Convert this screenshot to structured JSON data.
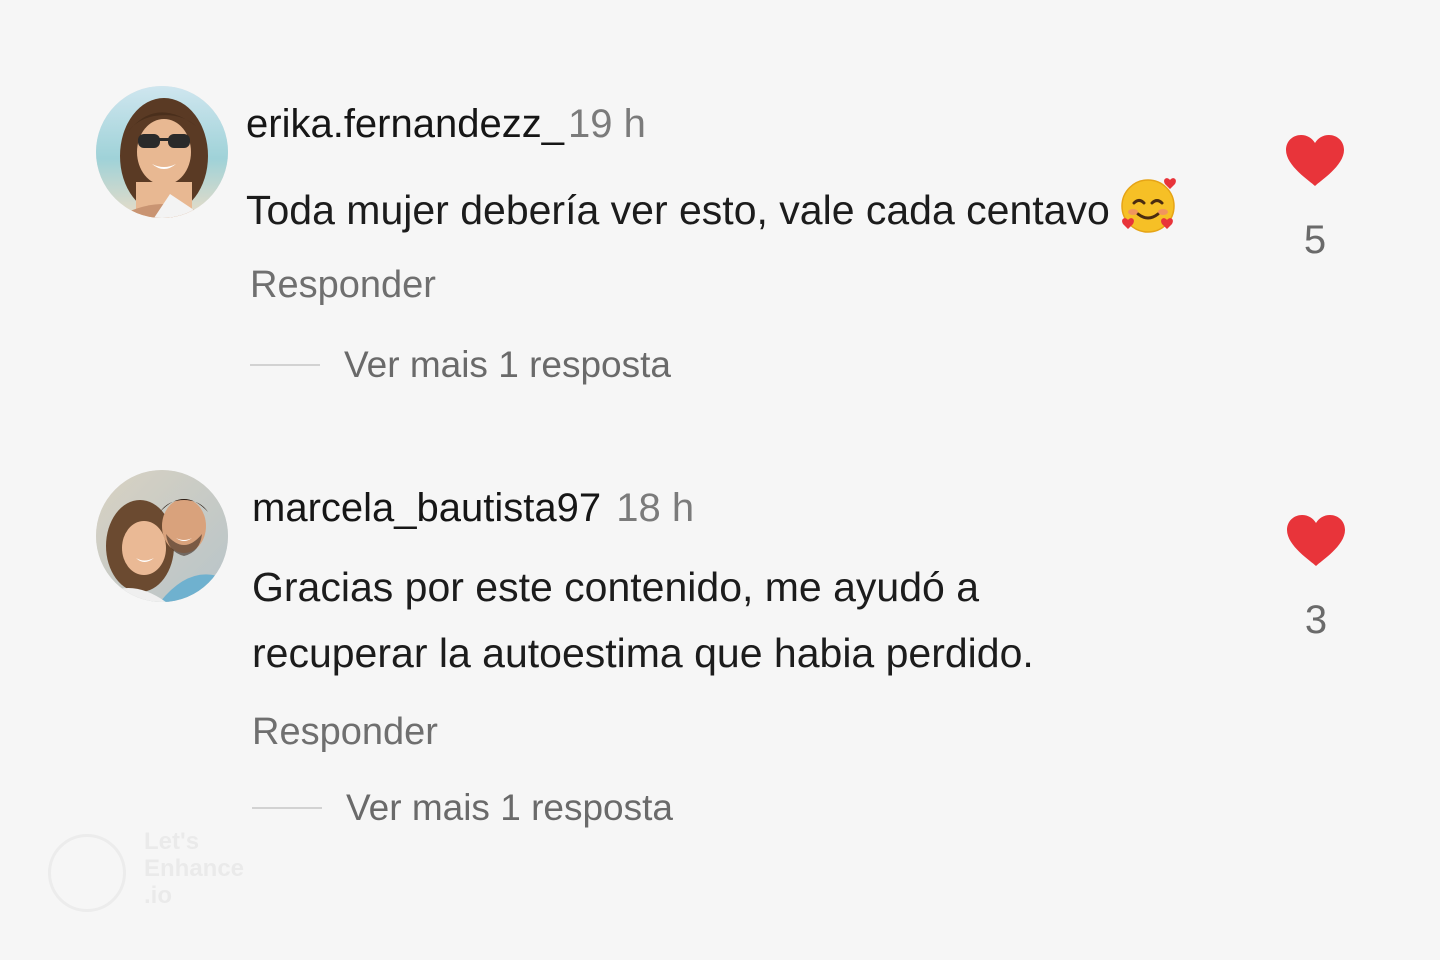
{
  "comments": [
    {
      "username": "erika.fernandezz_",
      "time": "19 h",
      "text_lines": [
        "Toda mujer debería ver esto, vale cada centavo"
      ],
      "emoji": "smiling-face-with-hearts",
      "reply_label": "Responder",
      "view_more_label": "Ver mais 1 resposta",
      "like_count": "5",
      "avatar": "woman-with-sunglasses-beach-avatar"
    },
    {
      "username": "marcela_bautista97",
      "time": "18 h",
      "text_lines": [
        "Gracias por este contenido, me ayudó a",
        "recuperar la autoestima que habia perdido."
      ],
      "reply_label": "Responder",
      "view_more_label": "Ver mais 1 resposta",
      "like_count": "3",
      "avatar": "couple-avatar"
    }
  ],
  "colors": {
    "background": "#f6f6f6",
    "heart": "#e8343a",
    "secondary_text": "#6f6f6f"
  },
  "watermark": {
    "text": "Let's\nEnhance\n.io"
  }
}
